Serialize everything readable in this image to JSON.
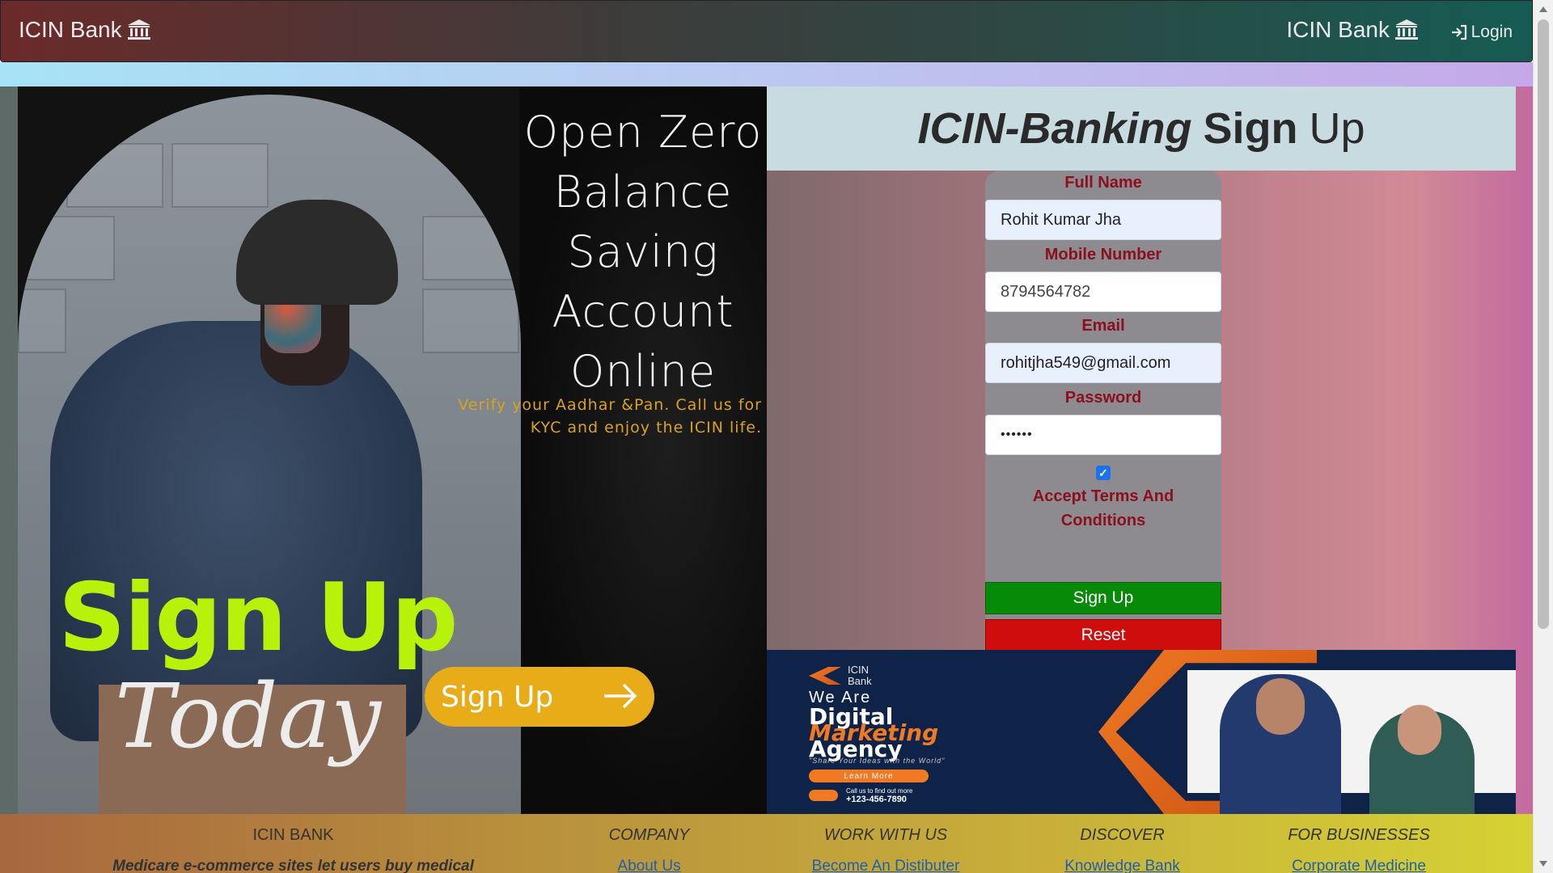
{
  "navbar": {
    "brand": "ICIN Bank",
    "brand_right": "ICIN Bank",
    "login_label": "Login",
    "icons": {
      "brand": "bank-icon",
      "login": "sign-in-icon"
    }
  },
  "promo": {
    "headline": [
      "Open Zero",
      "Balance",
      "Saving",
      "Account",
      "Online"
    ],
    "subtext": [
      "Verify your Aadhar &Pan. Call us for",
      "KYC and enjoy the ICIN life."
    ],
    "big_text": "Sign Up",
    "today": "Today",
    "cta_label": "Sign Up",
    "colors": {
      "big_text": "#b8f20b",
      "cta": "#e8ac18",
      "subtext": "#d9a21e"
    }
  },
  "form": {
    "title_part1": "ICIN-Banking",
    "title_part2": "Sign",
    "title_part3": "Up",
    "full_name_label": "Full Name",
    "full_name_value": "Rohit Kumar Jha",
    "mobile_label": "Mobile Number",
    "mobile_value": "8794564782",
    "email_label": "Email",
    "email_value": "rohitjha549@gmail.com",
    "password_label": "Password",
    "password_value": "••••••",
    "terms_checked": true,
    "terms_line1": "Accept Terms And",
    "terms_line2": "Conditions",
    "signup_label": "Sign Up",
    "reset_label": "Reset",
    "colors": {
      "label": "#8c0f1e",
      "signup": "#078a07",
      "reset": "#d00d0d"
    }
  },
  "ad": {
    "logo_line1": "ICIN",
    "logo_line2": "Bank",
    "we_are": "We Are",
    "digital": "Digital",
    "marketing": "Marketing",
    "agency": "Agency",
    "tagline": "\"Share Your Ideas with the World\"",
    "learn_more": "Learn More",
    "phone_label": "Call us to find out more",
    "phone": "+123-456-7890"
  },
  "footer": {
    "columns": [
      {
        "heading": "ICIN BANK",
        "text": "Medicare e-commerce sites let users buy medical"
      },
      {
        "heading": "COMPANY",
        "link": "About Us"
      },
      {
        "heading": "WORK WITH US",
        "link": "Become An Distibuter"
      },
      {
        "heading": "DISCOVER",
        "link": "Knowledge Bank"
      },
      {
        "heading": "FOR BUSINESSES",
        "link": "Corporate Medicine"
      }
    ]
  }
}
